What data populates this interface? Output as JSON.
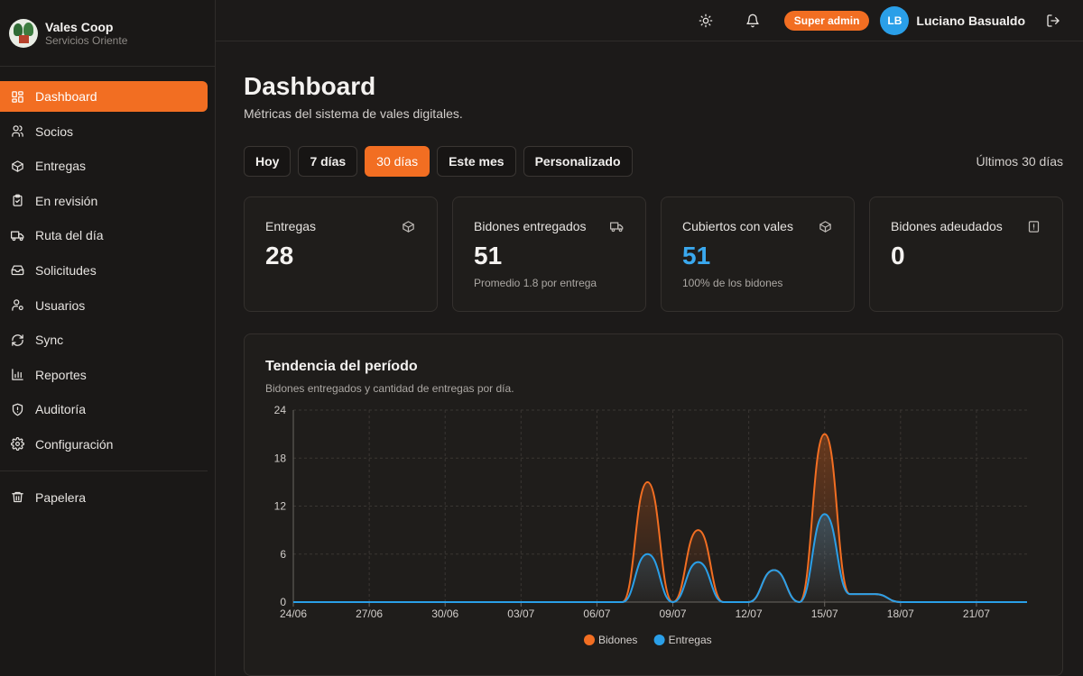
{
  "brand": {
    "title": "Vales Coop",
    "subtitle": "Servicios Oriente"
  },
  "sidebar": {
    "items": [
      {
        "label": "Dashboard",
        "icon": "dashboard-icon",
        "active": true
      },
      {
        "label": "Socios",
        "icon": "users-icon"
      },
      {
        "label": "Entregas",
        "icon": "box-icon"
      },
      {
        "label": "En revisión",
        "icon": "clipboard-icon"
      },
      {
        "label": "Ruta del día",
        "icon": "truck-icon"
      },
      {
        "label": "Solicitudes",
        "icon": "inbox-icon"
      },
      {
        "label": "Usuarios",
        "icon": "user-gear-icon"
      },
      {
        "label": "Sync",
        "icon": "sync-icon"
      },
      {
        "label": "Reportes",
        "icon": "bar-chart-icon"
      },
      {
        "label": "Auditoría",
        "icon": "shield-icon"
      },
      {
        "label": "Configuración",
        "icon": "gear-icon"
      }
    ],
    "trash": {
      "label": "Papelera",
      "icon": "trash-icon"
    }
  },
  "topbar": {
    "role_badge": "Super admin",
    "avatar_initials": "LB",
    "user_name": "Luciano Basualdo"
  },
  "page": {
    "title": "Dashboard",
    "subtitle": "Métricas del sistema de vales digitales."
  },
  "ranges": {
    "options": [
      "Hoy",
      "7 días",
      "30 días",
      "Este mes",
      "Personalizado"
    ],
    "selected": "30 días",
    "label": "Últimos 30 días"
  },
  "cards": [
    {
      "title": "Entregas",
      "value": "28",
      "note": "",
      "icon": "box-icon"
    },
    {
      "title": "Bidones entregados",
      "value": "51",
      "note": "Promedio 1.8 por entrega",
      "icon": "truck-icon"
    },
    {
      "title": "Cubiertos con vales",
      "value": "51",
      "note": "100% de los bidones",
      "icon": "box-icon"
    },
    {
      "title": "Bidones adeudados",
      "value": "0",
      "note": "",
      "icon": "alert-icon"
    }
  ],
  "colors": {
    "accent": "#f26e22",
    "bidones": "#f26e22",
    "entregas": "#2a9fe8"
  },
  "chart_data": {
    "type": "area",
    "title": "Tendencia del período",
    "subtitle": "Bidones entregados y cantidad de entregas por día.",
    "x_ticks": [
      "24/06",
      "27/06",
      "30/06",
      "03/07",
      "06/07",
      "09/07",
      "12/07",
      "15/07",
      "18/07",
      "21/07"
    ],
    "y_ticks": [
      0,
      6,
      12,
      18,
      24
    ],
    "ylim": [
      0,
      24
    ],
    "x": [
      "24/06",
      "25/06",
      "26/06",
      "27/06",
      "28/06",
      "29/06",
      "30/06",
      "01/07",
      "02/07",
      "03/07",
      "04/07",
      "05/07",
      "06/07",
      "07/07",
      "08/07",
      "09/07",
      "10/07",
      "11/07",
      "12/07",
      "13/07",
      "14/07",
      "15/07",
      "16/07",
      "17/07",
      "18/07",
      "19/07",
      "20/07",
      "21/07",
      "22/07",
      "23/07"
    ],
    "series": [
      {
        "name": "Bidones",
        "values": [
          0,
          0,
          0,
          0,
          0,
          0,
          0,
          0,
          0,
          0,
          0,
          0,
          0,
          0,
          15,
          0,
          9,
          0,
          0,
          4,
          0,
          21,
          1,
          1,
          0,
          0,
          0,
          0,
          0,
          0
        ]
      },
      {
        "name": "Entregas",
        "values": [
          0,
          0,
          0,
          0,
          0,
          0,
          0,
          0,
          0,
          0,
          0,
          0,
          0,
          0,
          6,
          0,
          5,
          0,
          0,
          4,
          0,
          11,
          1,
          1,
          0,
          0,
          0,
          0,
          0,
          0
        ]
      }
    ],
    "grid": true,
    "legend": "bottom-center"
  }
}
